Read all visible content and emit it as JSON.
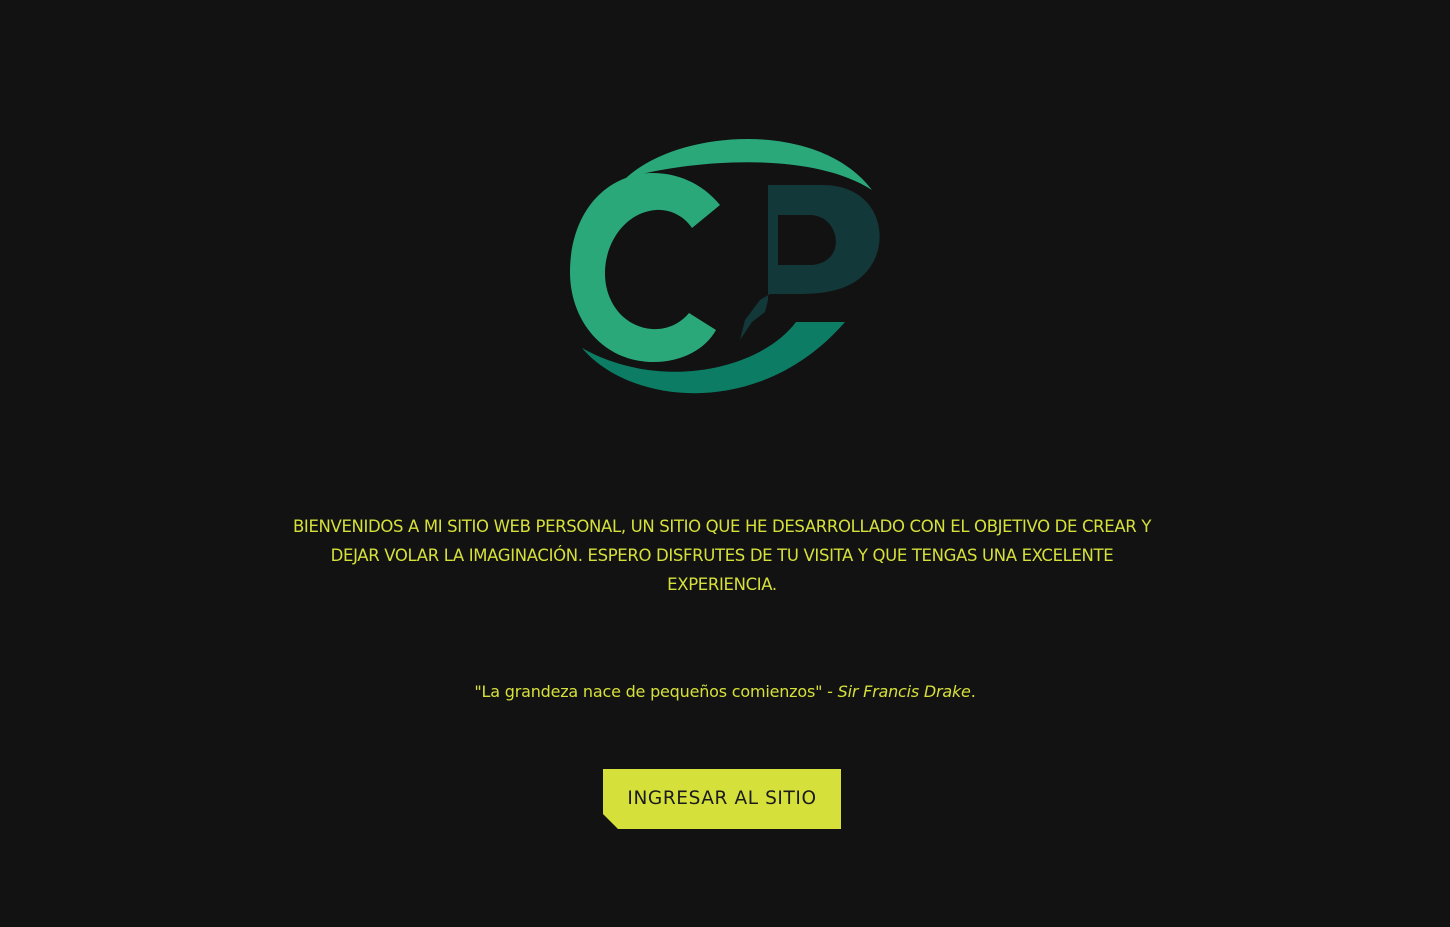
{
  "logo": {
    "text": "CP",
    "colors": {
      "c": "#2aa87a",
      "p": "#12383a",
      "swoosh_top": "#2aa87a",
      "swoosh_bottom": "#0c7d64"
    }
  },
  "welcome_text": "BIENVENIDOS A MI SITIO WEB PERSONAL, UN SITIO QUE HE DESARROLLADO CON EL OBJETIVO DE CREAR Y DEJAR VOLAR LA IMAGINACIÓN. ESPERO DISFRUTES DE TU VISITA Y QUE TENGAS UNA EXCELENTE EXPERIENCIA.",
  "quote": {
    "text": "\"La grandeza nace de pequeños comienzos\"",
    "separator": " - ",
    "author": "Sir Francis Drake",
    "end": "."
  },
  "enter_button_label": "INGRESAR AL SITIO",
  "colors": {
    "background": "#121212",
    "accent": "#d6e03a",
    "button_text": "#1b1b1b"
  }
}
